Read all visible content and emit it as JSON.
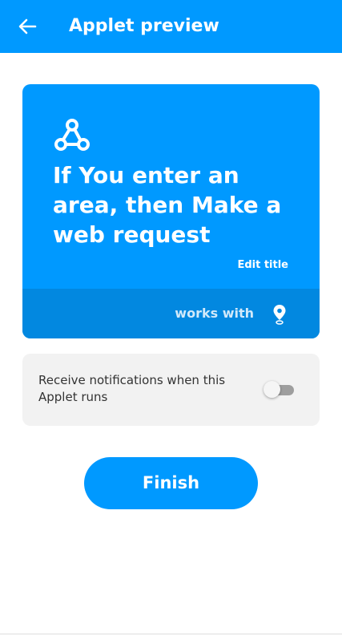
{
  "header": {
    "title": "Applet preview",
    "back_icon": "arrow-left-icon",
    "background_color": "#0099ff"
  },
  "applet_card": {
    "service_icon": "webhooks-icon",
    "title": "If You enter an area, then Make a web request",
    "edit_title_label": "Edit title",
    "works_with_label": "works with",
    "works_with_icon": "location-icon",
    "background_color": "#0099ff",
    "footer_color": "#0288e0"
  },
  "notifications": {
    "label": "Receive notifications when this Applet runs",
    "enabled": false
  },
  "finish_button": {
    "label": "Finish"
  }
}
